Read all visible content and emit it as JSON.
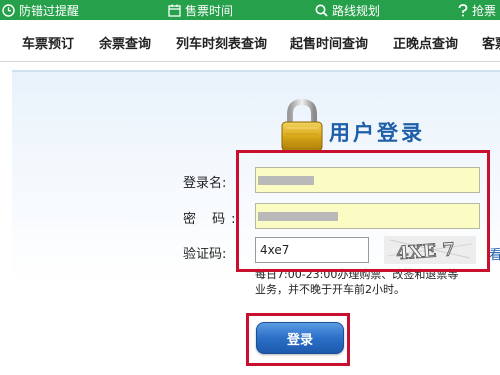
{
  "topbar": {
    "items": [
      {
        "icon": "clock-icon",
        "label": "防错过提醒"
      },
      {
        "icon": "calendar-icon",
        "label": "售票时间"
      },
      {
        "icon": "search-icon",
        "label": "路线规划"
      },
      {
        "icon": "question-icon",
        "label": "抢票"
      }
    ]
  },
  "nav": {
    "items": [
      "车票预订",
      "余票查询",
      "列车时刻表查询",
      "起售时间查询",
      "正晚点查询",
      "客票"
    ]
  },
  "login": {
    "title": "用户登录",
    "username_label": "登录名:",
    "password_label": "密 码:",
    "captcha_label": "验证码:",
    "captcha_value": "4xe7",
    "captcha_image_text": "4XE 7",
    "refresh_text": "看",
    "note": "每日7:00-23:00办理购票、改签和退票等业务，并不晚于开车前2小时。",
    "submit_label": "登录"
  },
  "colors": {
    "topbar": "#26a04a",
    "highlight": "#c8102e",
    "title": "#1f5ea8",
    "button": "#2b6fc7"
  }
}
